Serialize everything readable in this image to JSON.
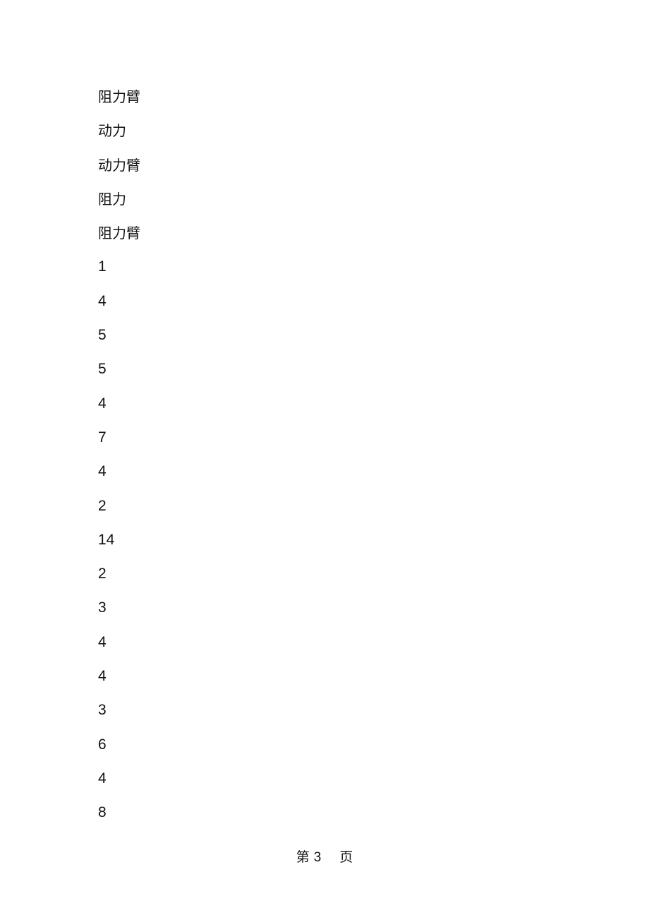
{
  "document": {
    "lines": [
      "阻力臂",
      "动力",
      "动力臂",
      "阻力",
      "阻力臂",
      "1",
      "4",
      "5",
      "5",
      "4",
      "7",
      "4",
      "2",
      "14",
      "2",
      "3",
      "4",
      "4",
      "3",
      "6",
      "4",
      "8"
    ],
    "footer": {
      "prefix": "第",
      "page_number": "3",
      "suffix": "页"
    }
  }
}
